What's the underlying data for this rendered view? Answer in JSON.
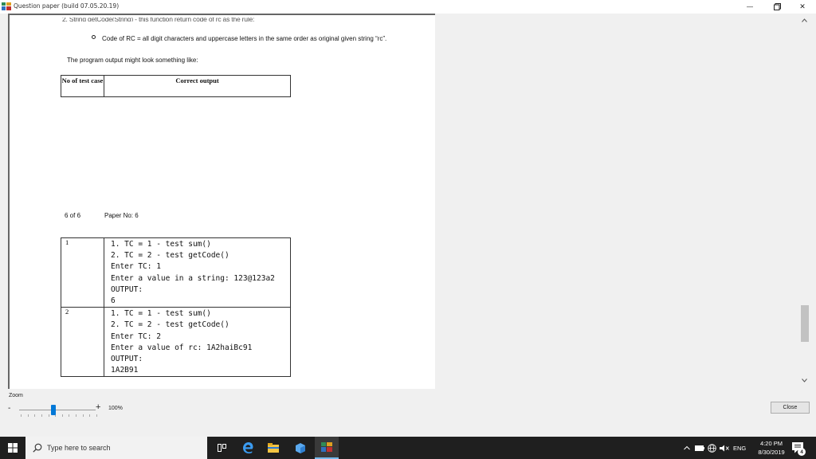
{
  "window": {
    "title": "Question paper (build 07.05.20.19)",
    "minimize_glyph": "—",
    "close_glyph": "✕"
  },
  "document": {
    "cut_off_line": "2. String getCode(String) - this function return code of rc as the rule:",
    "bullet_text": "Code of RC = all digit characters and uppercase letters in the same order as original given string “rc”.",
    "intro": "The program output might look something like:",
    "header_table": {
      "col1": "No of test case",
      "col2": "Correct output"
    },
    "footer": {
      "page": "6 of 6",
      "paper": "Paper No: 6"
    },
    "test_cases": [
      {
        "no": "1",
        "output": "1. TC = 1 - test sum()\n2. TC = 2 - test getCode()\nEnter TC: 1\nEnter a value in a string: 123@123a2\nOUTPUT:\n6"
      },
      {
        "no": "2",
        "output": "1. TC = 1 - test sum()\n2. TC = 2 - test getCode()\nEnter TC: 2\nEnter a value of rc: 1A2haiBc91\nOUTPUT:\n1A2B91"
      }
    ]
  },
  "zoom": {
    "label": "Zoom",
    "minus": "-",
    "plus": "+",
    "value": "100%",
    "slider_fraction": 0.45
  },
  "close_button": "Close",
  "taskbar": {
    "search_placeholder": "Type here to search",
    "language": "ENG",
    "time": "4:20 PM",
    "date": "8/30/2019",
    "notification_count": "4"
  },
  "colors": {
    "accent": "#0078d7",
    "taskbar": "#1f1f1f",
    "viewer_bg": "#f0f0f0"
  },
  "icons": [
    "app-icon",
    "minimize-icon",
    "maximize-icon",
    "close-icon",
    "scroll-up-icon",
    "scroll-down-icon",
    "windows-start-icon",
    "search-icon",
    "task-view-icon",
    "edge-icon",
    "file-explorer-icon",
    "store-icon",
    "app-taskbar-icon",
    "tray-chevron-icon",
    "battery-icon",
    "network-icon",
    "volume-icon",
    "notification-icon"
  ]
}
